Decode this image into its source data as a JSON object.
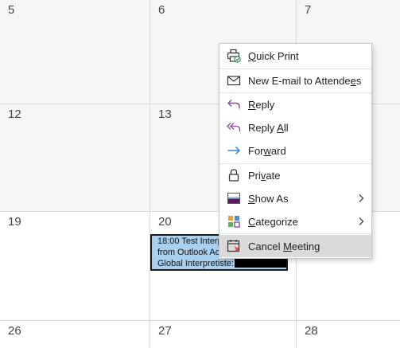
{
  "calendar": {
    "days": [
      "5",
      "6",
      "7",
      "12",
      "13",
      "19",
      "20",
      "26",
      "27",
      "28"
    ],
    "event": {
      "line1": "18:00 Test Interp",
      "line2": "from Outlook Ac",
      "line3": "Global Interpretiste:"
    }
  },
  "context_menu": {
    "items": [
      {
        "pre": "",
        "key": "Q",
        "post": "uick Print",
        "icon": "quick-print-icon"
      },
      {
        "pre": "New E-mail to Attende",
        "key": "e",
        "post": "s",
        "icon": "envelope-icon"
      },
      {
        "pre": "",
        "key": "R",
        "post": "eply",
        "icon": "reply-icon"
      },
      {
        "pre": "Reply ",
        "key": "A",
        "post": "ll",
        "icon": "reply-all-icon"
      },
      {
        "pre": "For",
        "key": "w",
        "post": "ard",
        "icon": "forward-arrow-icon"
      },
      {
        "pre": "Pri",
        "key": "v",
        "post": "ate",
        "icon": "lock-icon"
      },
      {
        "pre": "",
        "key": "S",
        "post": "how As",
        "icon": "show-as-icon"
      },
      {
        "pre": "",
        "key": "C",
        "post": "ategorize",
        "icon": "categorize-icon"
      },
      {
        "pre": "Cancel ",
        "key": "M",
        "post": "eeting",
        "icon": "cancel-meeting-icon"
      }
    ],
    "highlighted_item": "Cancel Meeting"
  },
  "colors": {
    "accent_purple": "#8a4b9c",
    "accent_blue": "#2b7cd3",
    "event_fill": "#a9d0ef",
    "highlight": "#dadada",
    "cancel_red": "#d13438"
  }
}
